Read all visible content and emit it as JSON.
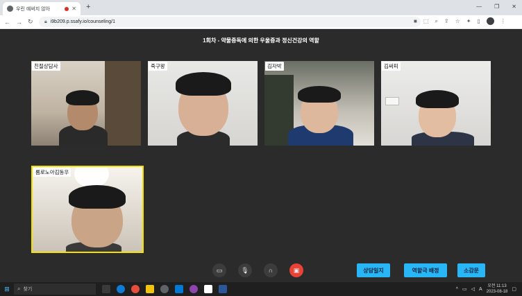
{
  "browser": {
    "tab_title": "우린 얘써지 않아",
    "new_tab": "+",
    "url": "i9b209.p.ssafy.io/counseling/1",
    "window_controls": [
      "—",
      "❐",
      "✕"
    ]
  },
  "session": {
    "title": "1회차 - 약물중독에 의한 우울증과 정신건강의 역할"
  },
  "participants": [
    {
      "name": "친절상담사"
    },
    {
      "name": "죽구왕"
    },
    {
      "name": "김자박"
    },
    {
      "name": "김싸피"
    },
    {
      "name": "룸로노아김동우"
    }
  ],
  "controls": {
    "camera_icon": "video-camera-icon",
    "mic_icon": "microphone-icon",
    "headset_icon": "headset-icon",
    "leave_icon": "leave-call-icon"
  },
  "actions": {
    "log_label": "상담일지",
    "role_label": "역할극 배정",
    "review_label": "소감문"
  },
  "taskbar": {
    "search_label": "찾기",
    "time": "오전 11:13",
    "date": "2023-08-18",
    "lang": "A"
  },
  "colors": {
    "accent": "#29b6f6",
    "active_speaker_border": "#f5e100",
    "leave": "#ea4335"
  }
}
